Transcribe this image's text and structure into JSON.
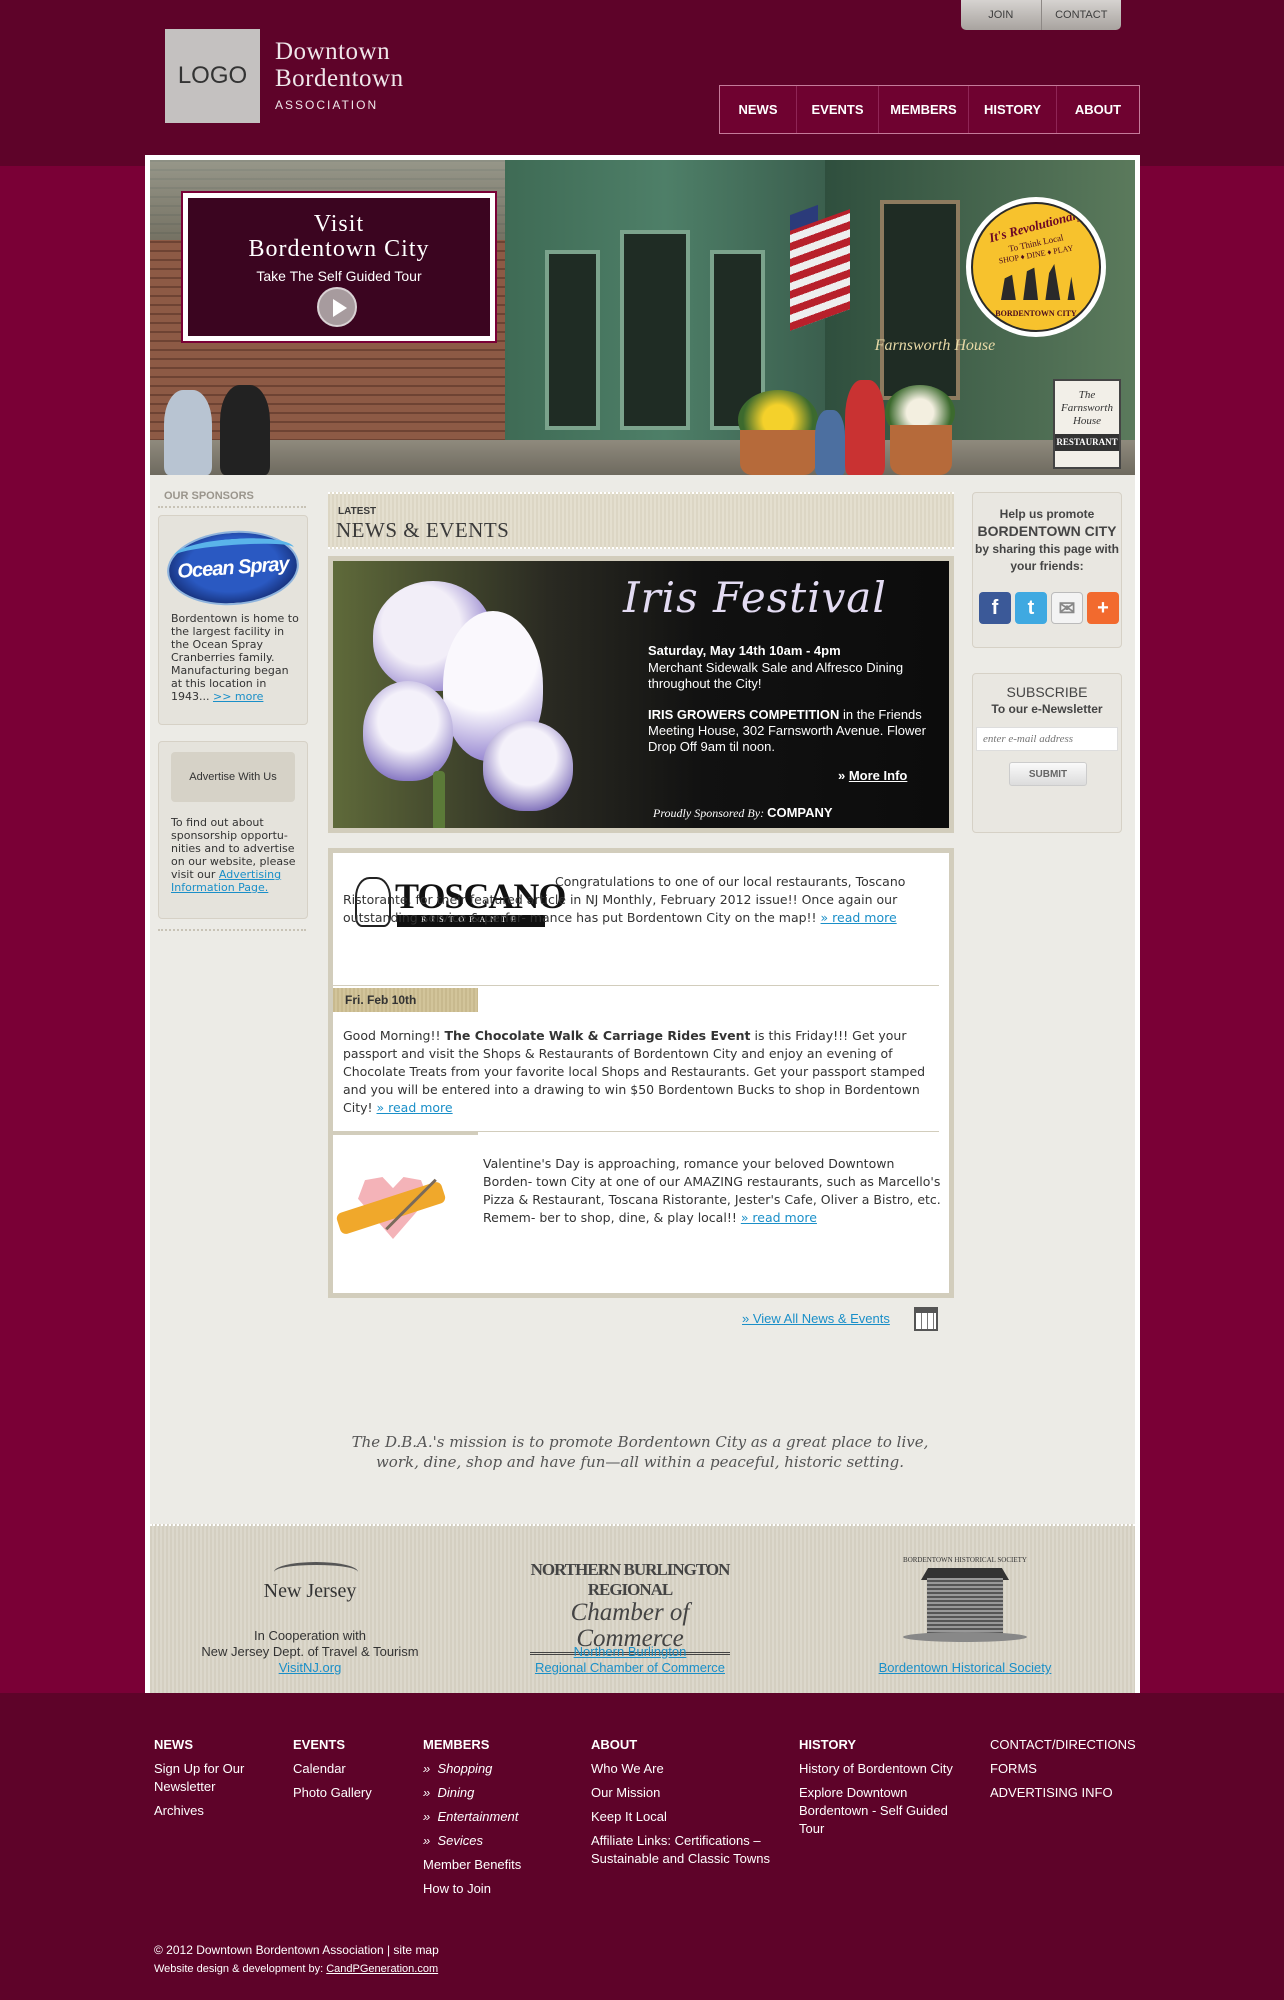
{
  "header": {
    "top_links": [
      "JOIN",
      "CONTACT"
    ],
    "logo_text": "LOGO",
    "brand_line1": "Downtown",
    "brand_line2": "Bordentown",
    "brand_line3": "ASSOCIATION",
    "nav": [
      "NEWS",
      "EVENTS",
      "MEMBERS",
      "HISTORY",
      "ABOUT"
    ]
  },
  "hero": {
    "visit_line1": "Visit",
    "visit_line2": "Bordentown City",
    "visit_line3": "Take The Self Guided Tour",
    "store_sign": "Farnsworth House",
    "badge_line1": "It's Revolutionary",
    "badge_line2": "To Think Local",
    "badge_line3": "SHOP ♦ DINE ♦ PLAY",
    "badge_line4": "BORDENTOWN CITY",
    "sign_line1": "The",
    "sign_line2": "Farnsworth",
    "sign_line3": "House",
    "sign_line4": "RESTAURANT"
  },
  "sponsors": {
    "heading": "OUR SPONSORS",
    "sponsor_logo": "Ocean Spray",
    "sponsor_text": "Bordentown is home to the largest facility in the Ocean Spray Cranberries family. Manufacturing began at this location in 1943... ",
    "sponsor_more": ">> more",
    "advertise_button": "Advertise With Us",
    "advertise_text": "To find out about sponsorship opportu- nities and to advertise on our website, please visit our ",
    "advertise_link": "Advertising Information Page."
  },
  "news": {
    "latest_label": "LATEST",
    "heading": "NEWS & EVENTS",
    "iris_title": "Iris Festival",
    "iris_date": "Saturday, May 14th 10am - 4pm",
    "iris_line2": "Merchant Sidewalk Sale and Alfresco Dining throughout the City!",
    "iris_bold": "IRIS GROWERS COMPETITION",
    "iris_line3": " in the Friends Meeting House, 302 Farnsworth Avenue. Flower Drop Off 9am til noon.",
    "iris_more_prefix": "» ",
    "iris_more": "More Info",
    "iris_sponsored": "Proudly Sponsored By:",
    "iris_company": "COMPANY",
    "toscano_logo": "TOSCANO",
    "toscano_sub": "RISTORANTE",
    "item1_text": "Congratulations to one of our local restaurants, Toscano Ristorante, for their featured article in NJ Monthly, February 2012 issue!! Once again our outstanding service & perfor- mance has put Bordentown City on the map!! ",
    "read_more": "» read more",
    "date_tag": "Fri. Feb 10th",
    "item2_pre": "Good Morning!! ",
    "item2_bold": "The Chocolate Walk & Carriage Rides Event",
    "item2_text": " is this Friday!!! Get your passport and visit the Shops & Restaurants of Bordentown City and enjoy an evening of Chocolate Treats from your favorite local Shops and Restaurants. Get your passport stamped and you will be entered into a drawing to win $50 Bordentown Bucks to shop in Bordentown City! ",
    "item3_text": "Valentine's Day is approaching, romance your beloved Downtown Borden- town City at one of our AMAZING restaurants, such as Marcello's Pizza & Restaurant, Toscana Ristorante, Jester's Cafe, Oliver a Bistro, etc. Remem- ber to shop, dine, & play local!! ",
    "view_all": "» View All News & Events"
  },
  "share": {
    "line1": "Help us promote",
    "line2": "BORDENTOWN CITY",
    "line3": "by sharing this page with your friends:",
    "icons": [
      "f",
      "t",
      "✉",
      "+"
    ]
  },
  "subscribe": {
    "title": "SUBSCRIBE",
    "subtitle": "To our e-Newsletter",
    "placeholder": "enter e-mail address",
    "button": "SUBMIT"
  },
  "mission": "The D.B.A.'s mission is to promote Bordentown City as a great place to live, work, dine, shop and have fun—all within a peaceful, historic setting.",
  "partners": {
    "nj_logo": "New Jersey",
    "nj_text1": "In Cooperation with",
    "nj_text2": "New Jersey Dept. of Travel & Tourism",
    "nj_link": "VisitNJ.org",
    "cc_logo_a": "NORTHERN BURLINGTON REGIONAL",
    "cc_logo_b": "Chamber of Commerce",
    "cc_link1": "Northern Burlington",
    "cc_link2": "Regional Chamber of Commerce",
    "hs_logo": "BORDENTOWN HISTORICAL SOCIETY",
    "hs_link": "Bordentown Historical Society"
  },
  "footer": {
    "news_head": "NEWS",
    "news_items": [
      "Sign Up for Our Newsletter",
      "Archives"
    ],
    "events_head": "EVENTS",
    "events_items": [
      "Calendar",
      "Photo Gallery"
    ],
    "members_head": "MEMBERS",
    "members_items": [
      "Shopping",
      "Dining",
      "Entertainment",
      "Sevices",
      "Member Benefits",
      "How to Join"
    ],
    "about_head": "ABOUT",
    "about_items": [
      "Who We Are",
      "Our Mission",
      "Keep It Local",
      "Affiliate Links: Certifications – Sustainable and Classic Towns"
    ],
    "history_head": "HISTORY",
    "history_items": [
      "History of Bordentown City",
      "Explore Downtown Bordentown - Self Guided Tour"
    ],
    "misc_items": [
      "CONTACT/DIRECTIONS",
      "FORMS",
      "ADVERTISING INFO"
    ],
    "copyright": "© 2012 Downtown Bordentown Association  |  site map",
    "credit": "Website design & development by: ",
    "credit_link": "CandPGeneration.com"
  }
}
